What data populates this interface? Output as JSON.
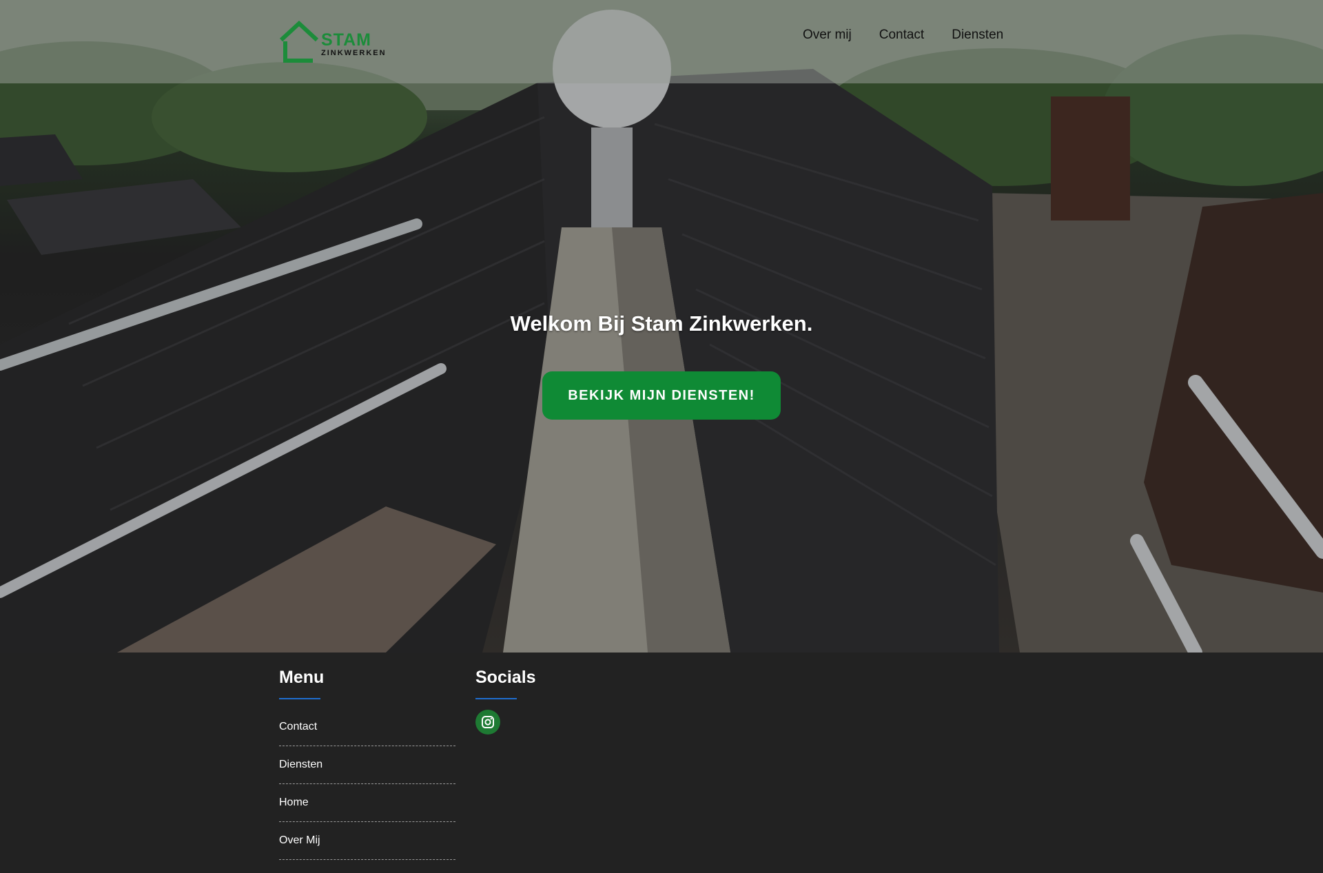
{
  "logo": {
    "name": "STAM",
    "sub": "ZINKWERKEN",
    "color": "#1c8c3a"
  },
  "nav": {
    "items": [
      "Over mij",
      "Contact",
      "Diensten"
    ]
  },
  "hero": {
    "title": "Welkom Bij Stam Zinkwerken.",
    "cta_label": "BEKIJK MIJN DIENSTEN!",
    "cta_color": "#0f8a35"
  },
  "footer": {
    "menu_title": "Menu",
    "menu_items": [
      "Contact",
      "Diensten",
      "Home",
      "Over Mij"
    ],
    "socials_title": "Socials",
    "socials": [
      {
        "icon": "instagram-icon",
        "color": "#1e7a33"
      }
    ],
    "accent_color": "#1f6fd1",
    "background": "#222222"
  }
}
